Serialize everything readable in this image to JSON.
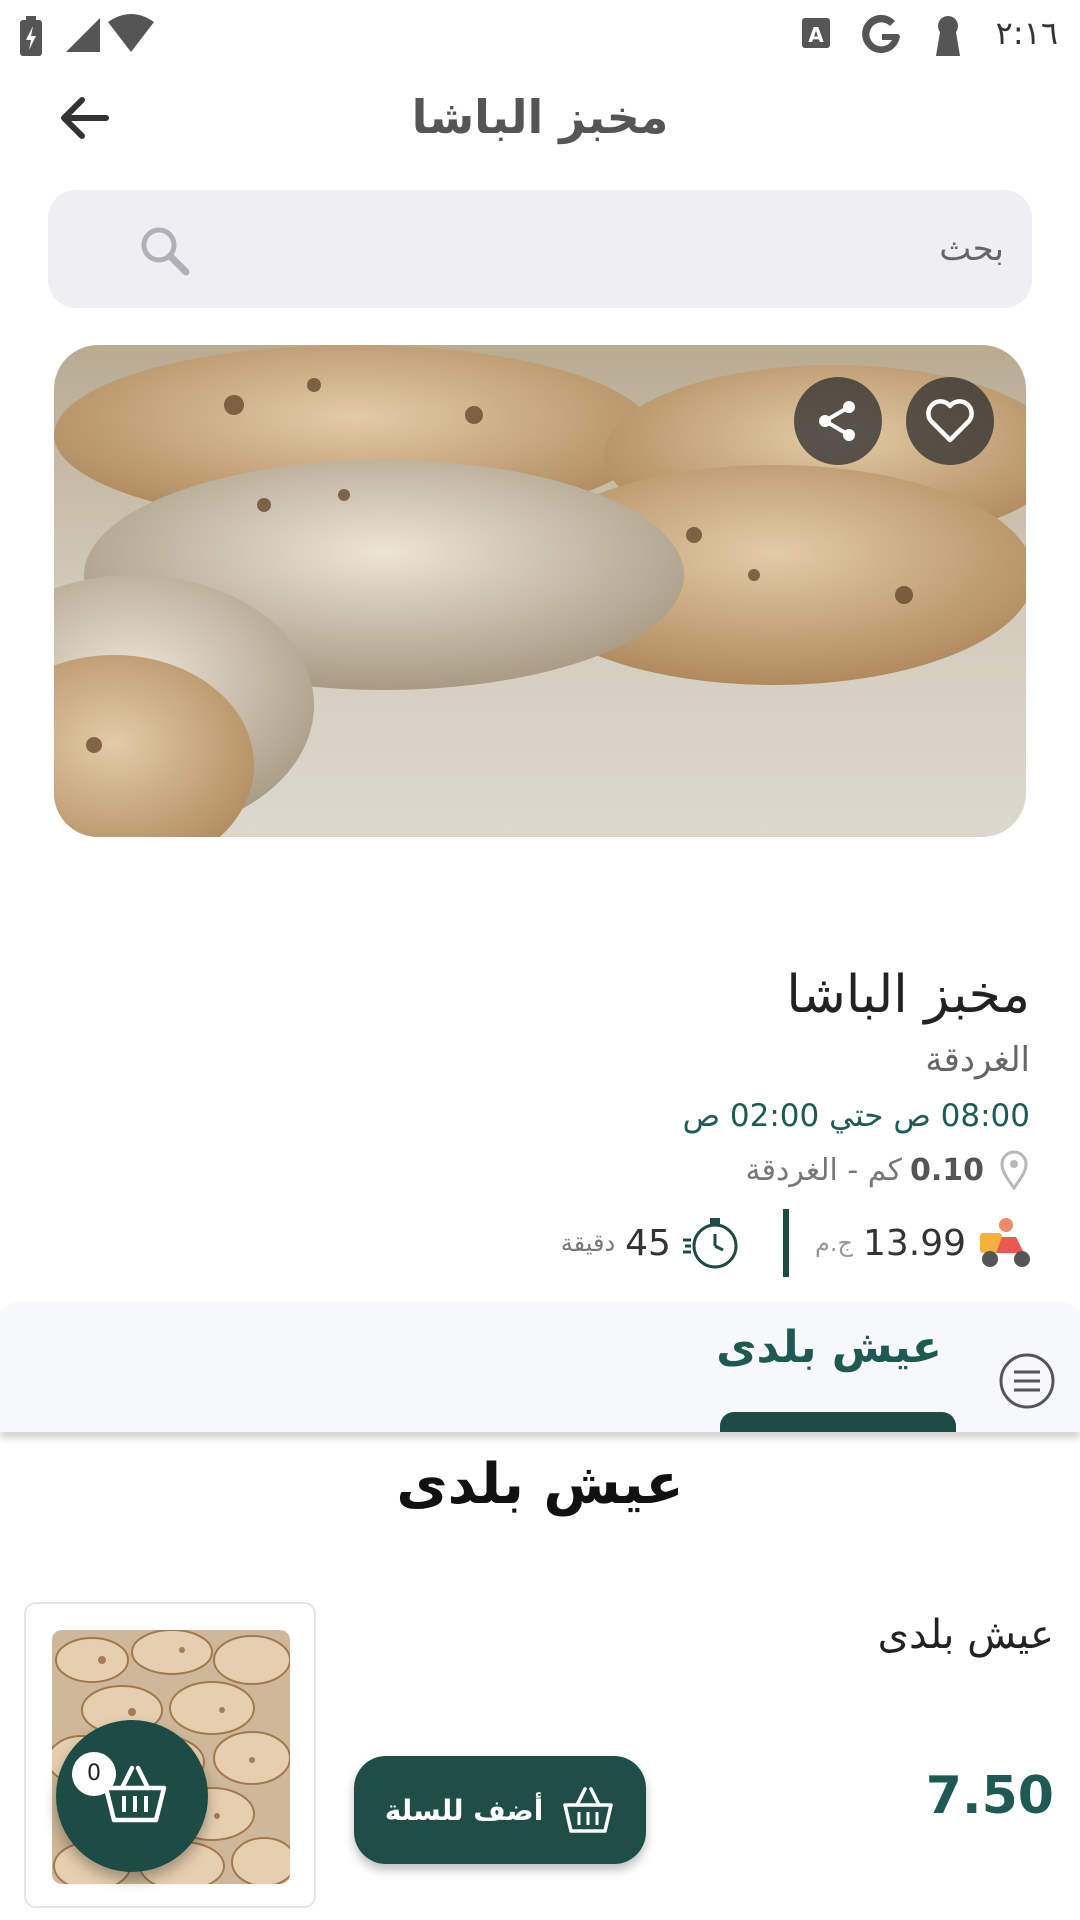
{
  "status_bar": {
    "time": "٢:١٦"
  },
  "app_bar": {
    "title": "مخبز الباشا"
  },
  "search": {
    "placeholder": "بحث"
  },
  "store": {
    "name": "مخبز الباشا",
    "city": "الغردقة",
    "hours": "08:00 ص حتي 02:00 ص",
    "distance_value": "0.10",
    "distance_text": "كم - الغردقة",
    "delivery_fee": "13.99",
    "currency": "ج.م",
    "eta_value": "45",
    "eta_unit": "دقيقة"
  },
  "category_tab": {
    "label": "عيش بلدى"
  },
  "section": {
    "title": "عيش بلدى"
  },
  "product": {
    "name": "عيش بلدى",
    "price": "7.50",
    "add_label": "أضف للسلة"
  },
  "cart": {
    "count": "0"
  },
  "colors": {
    "primary": "#1d4b45",
    "accent_text": "#1e5953",
    "search_bg": "#eeeef3"
  }
}
